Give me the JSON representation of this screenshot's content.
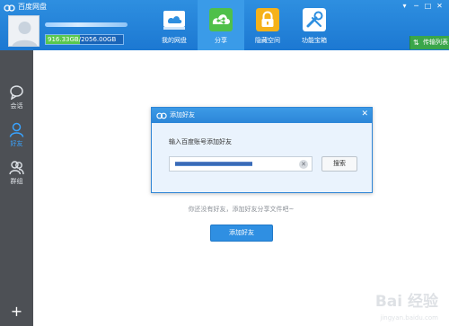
{
  "app": {
    "title": "百度网盘"
  },
  "window_controls": [
    "▾",
    "─",
    "□",
    "✕"
  ],
  "user": {
    "quota_used": "916.33GB",
    "quota_total": "2056.00GB",
    "quota_text": "916.33GB/2056.00GB",
    "quota_fraction": 0.4457
  },
  "nav": {
    "items": [
      {
        "label": "我的网盘",
        "icon": "cloud-drive-icon",
        "color": "#ffffff"
      },
      {
        "label": "分享",
        "icon": "share-icon",
        "color": "#4fc04a",
        "active": true
      },
      {
        "label": "隐藏空间",
        "icon": "lock-icon",
        "color": "#f5b21a"
      },
      {
        "label": "功能宝箱",
        "icon": "toolbox-icon",
        "color": "#ffffff"
      }
    ]
  },
  "transfer": {
    "icon": "⇅",
    "label": "传输列表"
  },
  "sidebar": {
    "items": [
      {
        "label": "会话",
        "icon": "chat-icon"
      },
      {
        "label": "好友",
        "icon": "friend-icon",
        "active": true
      },
      {
        "label": "群组",
        "icon": "group-icon"
      }
    ],
    "add_label": "+"
  },
  "main": {
    "empty_text": "你还没有好友，添加好友分享文件吧~",
    "add_friend_button": "添加好友"
  },
  "dialog": {
    "title": "添加好友",
    "close_label": "✕",
    "prompt": "输入百度账号添加好友",
    "input_value": "",
    "clear_label": "✕",
    "search_button": "搜索"
  },
  "watermark": {
    "text": "Bai 经验",
    "sub": "jingyan.baidu.com"
  },
  "colors": {
    "header": "#1f7bd4",
    "sidebar": "#4d5055",
    "accent": "#2f8fe2",
    "green": "#3aa64a"
  }
}
